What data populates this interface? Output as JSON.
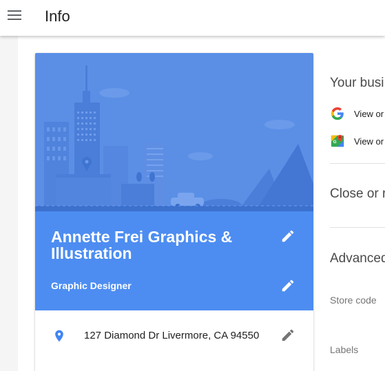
{
  "header": {
    "title": "Info",
    "menu_icon": "hamburger-menu-icon"
  },
  "business": {
    "name": "Annette Frei Graphics & Illustration",
    "category": "Graphic Designer",
    "address": "127 Diamond Dr Livermore, CA 94550",
    "edit_icon": "pencil-icon",
    "location_icon": "map-pin-icon"
  },
  "right_panel": {
    "your_business_title": "Your busi",
    "view_google": "View or",
    "view_maps": "View or",
    "close_title": "Close or r",
    "advanced_title": "Advanced",
    "store_code_label": "Store code",
    "labels_label": "Labels"
  },
  "colors": {
    "accent": "#4d8df1",
    "hero_sky": "#5b8fe6",
    "pin": "#4285f4"
  }
}
